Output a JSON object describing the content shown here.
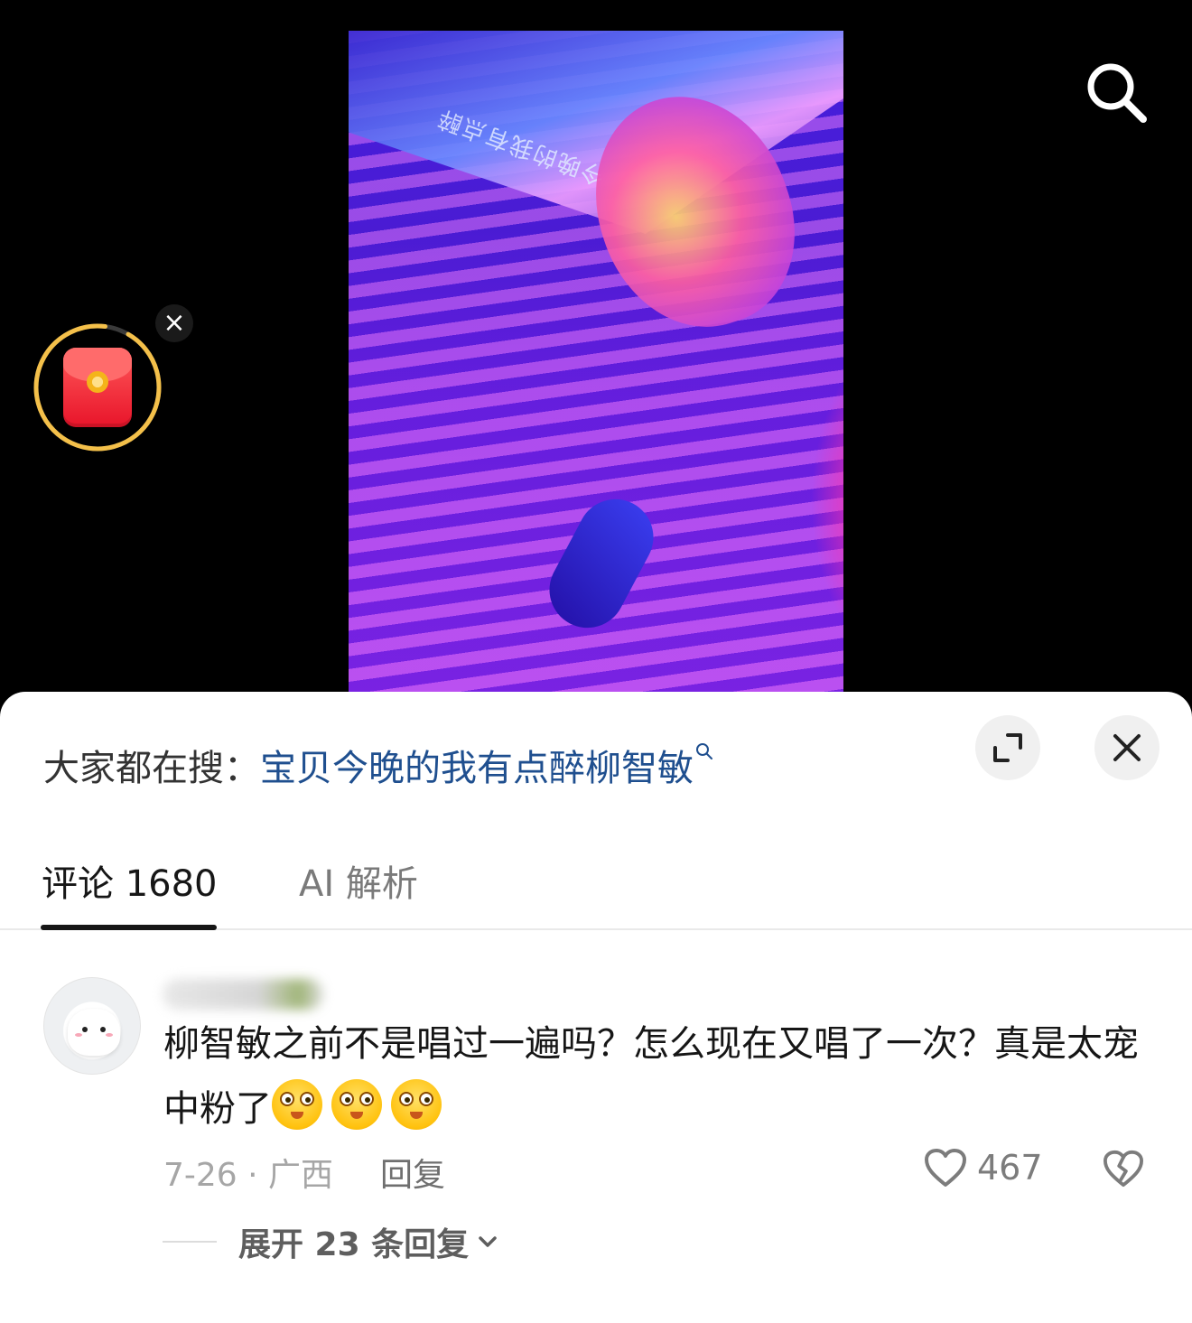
{
  "video": {
    "screen_caption": "今晚的我有点醉"
  },
  "panel": {
    "hot_search_prefix": "大家都在搜：",
    "hot_search_query": "宝贝今晚的我有点醉柳智敏",
    "tabs": [
      {
        "label": "评论 1680",
        "active": true
      },
      {
        "label": "AI 解析",
        "active": false
      }
    ]
  },
  "comment": {
    "text": "柳智敏之前不是唱过一遍吗？怎么现在又唱了一次？真是太宠中粉了",
    "emojis": [
      "star-eyes-emoji",
      "star-eyes-emoji",
      "star-eyes-emoji"
    ],
    "date_location": "7-26 · 广西",
    "reply_label": "回复",
    "like_count": "467",
    "expand_replies_label": "展开 23 条回复"
  },
  "colors": {
    "link": "#1f4f8f",
    "redpack_ring": "#f4c04a",
    "redpack": "#e8142a"
  },
  "icons": [
    "search-icon",
    "close-icon",
    "expand-icon",
    "heart-icon",
    "broken-heart-icon",
    "chevron-down-icon",
    "red-envelope-icon"
  ]
}
